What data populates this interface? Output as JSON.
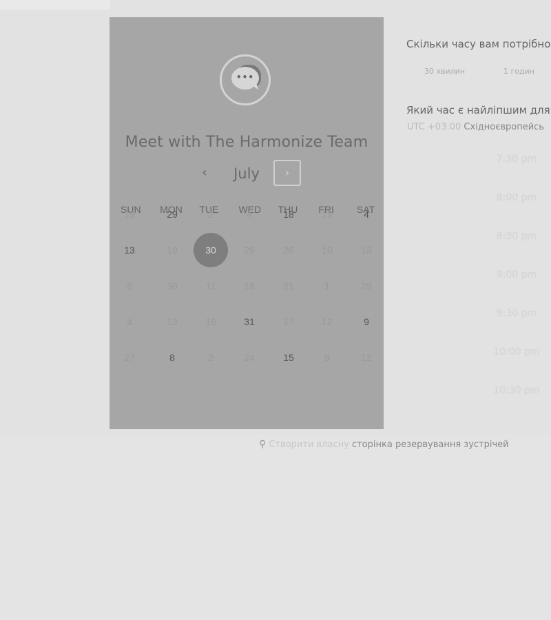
{
  "calendar": {
    "title": "Meet with The Harmonize Team",
    "month": "July",
    "prev_icon": "‹",
    "next_icon": "›",
    "avatar_dots": "•••",
    "weekdays": [
      "SUN",
      "MON",
      "TUE",
      "WED",
      "THU",
      "FRI",
      "SAT"
    ],
    "weeks": [
      [
        "19",
        "29",
        "2",
        "4",
        "18",
        "19",
        "4"
      ],
      [
        "13",
        "19",
        "30",
        "29",
        "26",
        "10",
        "13"
      ],
      [
        "8",
        "30",
        "11",
        "18",
        "21",
        "1",
        "29"
      ],
      [
        "4",
        "13",
        "16",
        "31",
        "17",
        "12",
        "9"
      ],
      [
        "27",
        "8",
        "2",
        "24",
        "15",
        "9",
        "12"
      ]
    ],
    "available": [
      [
        false,
        true,
        false,
        false,
        true,
        false,
        true
      ],
      [
        true,
        false,
        false,
        false,
        false,
        false,
        false
      ],
      [
        false,
        false,
        false,
        false,
        false,
        false,
        false
      ],
      [
        false,
        false,
        false,
        true,
        false,
        false,
        true
      ],
      [
        false,
        true,
        false,
        false,
        true,
        false,
        false
      ]
    ],
    "selected": {
      "week": 1,
      "day": 2
    }
  },
  "duration": {
    "question": "Скільки часу вам потрібно",
    "options": [
      "30 хвилин",
      "1 годин"
    ]
  },
  "time": {
    "question": "Який час є найліпшим для",
    "tz_offset": "UTC +03:00",
    "tz_name": "Східноєвропейсь",
    "slots": [
      "7:30 pm",
      "8:00 pm",
      "8:30 pm",
      "9:00 pm",
      "9:30 pm",
      "10:00 pm",
      "10:30 pm"
    ]
  },
  "footer": {
    "sprocket_icon": "⚲",
    "prefix": "Створити власну",
    "link": "сторінка резервування зустрічей"
  }
}
